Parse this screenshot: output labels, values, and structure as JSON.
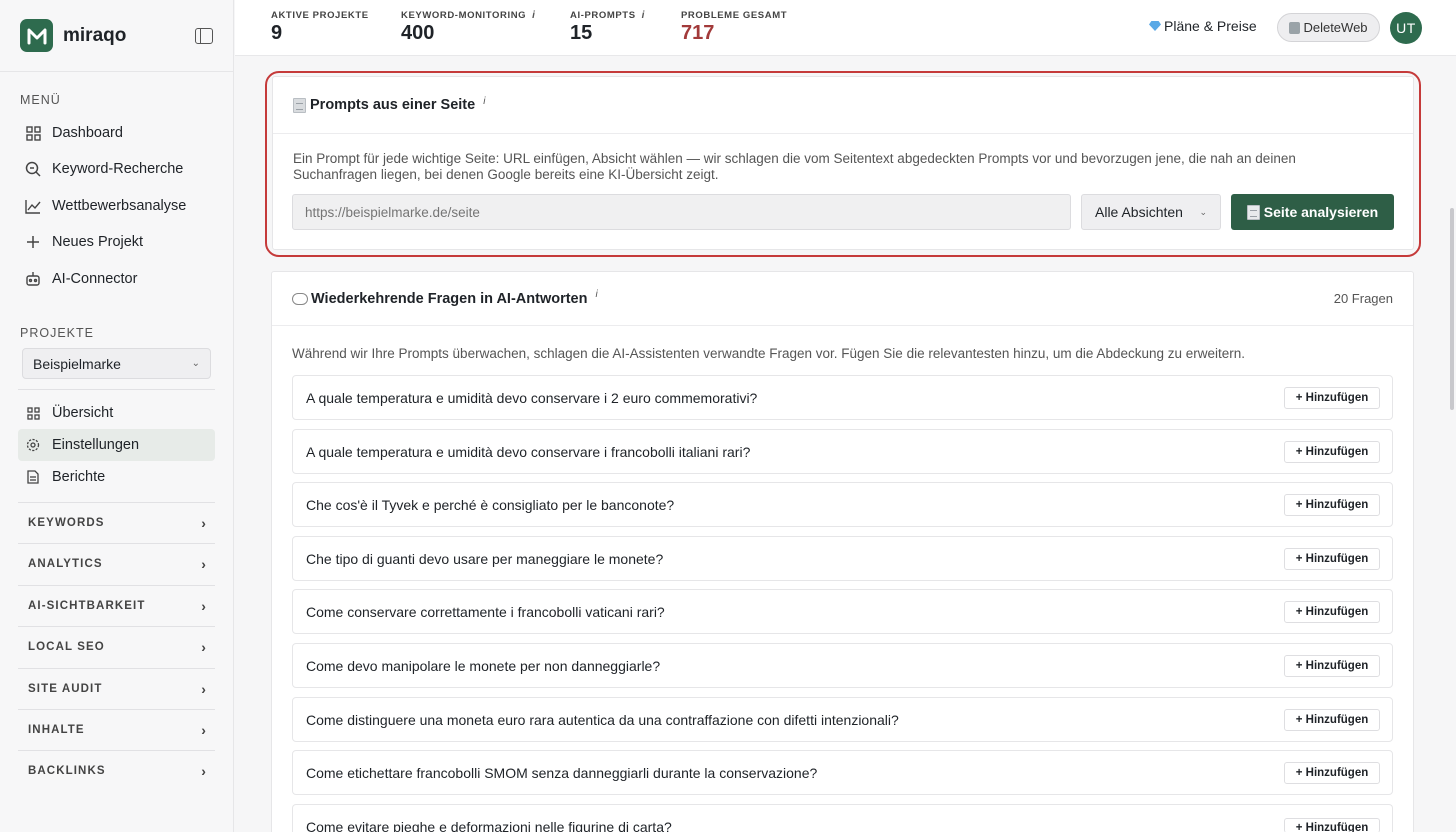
{
  "app": {
    "logo_text": "miraqo"
  },
  "sidebar": {
    "menu_label": "MENÜ",
    "nav": [
      {
        "label": "Dashboard",
        "icon": "grid-icon"
      },
      {
        "label": "Keyword-Recherche",
        "icon": "search-icon"
      },
      {
        "label": "Wettbewerbsanalyse",
        "icon": "line-chart-icon"
      },
      {
        "label": "Neues Projekt",
        "icon": "plus-icon"
      },
      {
        "label": "AI-Connector",
        "icon": "robot-icon"
      }
    ],
    "projects_label": "PROJEKTE",
    "project_selected": "Beispielmarke",
    "project_nav": [
      {
        "label": "Übersicht",
        "icon": "grid-icon"
      },
      {
        "label": "Einstellungen",
        "icon": "gear-icon",
        "active": true
      },
      {
        "label": "Berichte",
        "icon": "document-icon"
      }
    ],
    "groups": [
      "KEYWORDS",
      "ANALYTICS",
      "AI-SICHTBARKEIT",
      "LOCAL SEO",
      "SITE AUDIT",
      "INHALTE",
      "BACKLINKS"
    ]
  },
  "topbar": {
    "stats": [
      {
        "label": "AKTIVE PROJEKTE",
        "value": "9",
        "info": ""
      },
      {
        "label": "KEYWORD-MONITORING",
        "value": "400",
        "info": "i"
      },
      {
        "label": "AI-PROMPTS",
        "value": "15",
        "info": "i"
      },
      {
        "label": "PROBLEME GESAMT",
        "value": "717",
        "info": "",
        "color": "#a23a3a"
      }
    ],
    "plans_label": "Pläne & Preise",
    "workspace_label": "DeleteWeb",
    "avatar_initials": "UT"
  },
  "prompts_card": {
    "title": "Prompts aus einer Seite",
    "info": "i",
    "description": "Ein Prompt für jede wichtige Seite: URL einfügen, Absicht wählen — wir schlagen die vom Seitentext abgedeckten Prompts vor und bevorzugen jene, die nah an deinen Suchanfragen liegen, bei denen Google bereits eine KI-Übersicht zeigt.",
    "url_placeholder": "https://beispielmarke.de/seite",
    "intent_selected": "Alle Absichten",
    "analyze_label": "Seite analysieren"
  },
  "questions_card": {
    "title": "Wiederkehrende Fragen in AI-Antworten",
    "info": "i",
    "count": "20 Fragen",
    "description": "Während wir Ihre Prompts überwachen, schlagen die AI-Assistenten verwandte Fragen vor. Fügen Sie die relevantesten hinzu, um die Abdeckung zu erweitern.",
    "add_label": "+ Hinzufügen",
    "questions": [
      "A quale temperatura e umidità devo conservare i 2 euro commemorativi?",
      "A quale temperatura e umidità devo conservare i francobolli italiani rari?",
      "Che cos'è il Tyvek e perché è consigliato per le banconote?",
      "Che tipo di guanti devo usare per maneggiare le monete?",
      "Come conservare correttamente i francobolli vaticani rari?",
      "Come devo manipolare le monete per non danneggiarle?",
      "Come distinguere una moneta euro rara autentica da una contraffazione con difetti intenzionali?",
      "Come etichettare francobolli SMOM senza danneggiarli durante la conservazione?",
      "Come evitare pieghe e deformazioni nelle figurine di carta?"
    ]
  },
  "colors": {
    "brand": "#2e6b4e",
    "button": "#2e5e46",
    "highlight": "#c53a3a",
    "alert": "#a23a3a"
  }
}
